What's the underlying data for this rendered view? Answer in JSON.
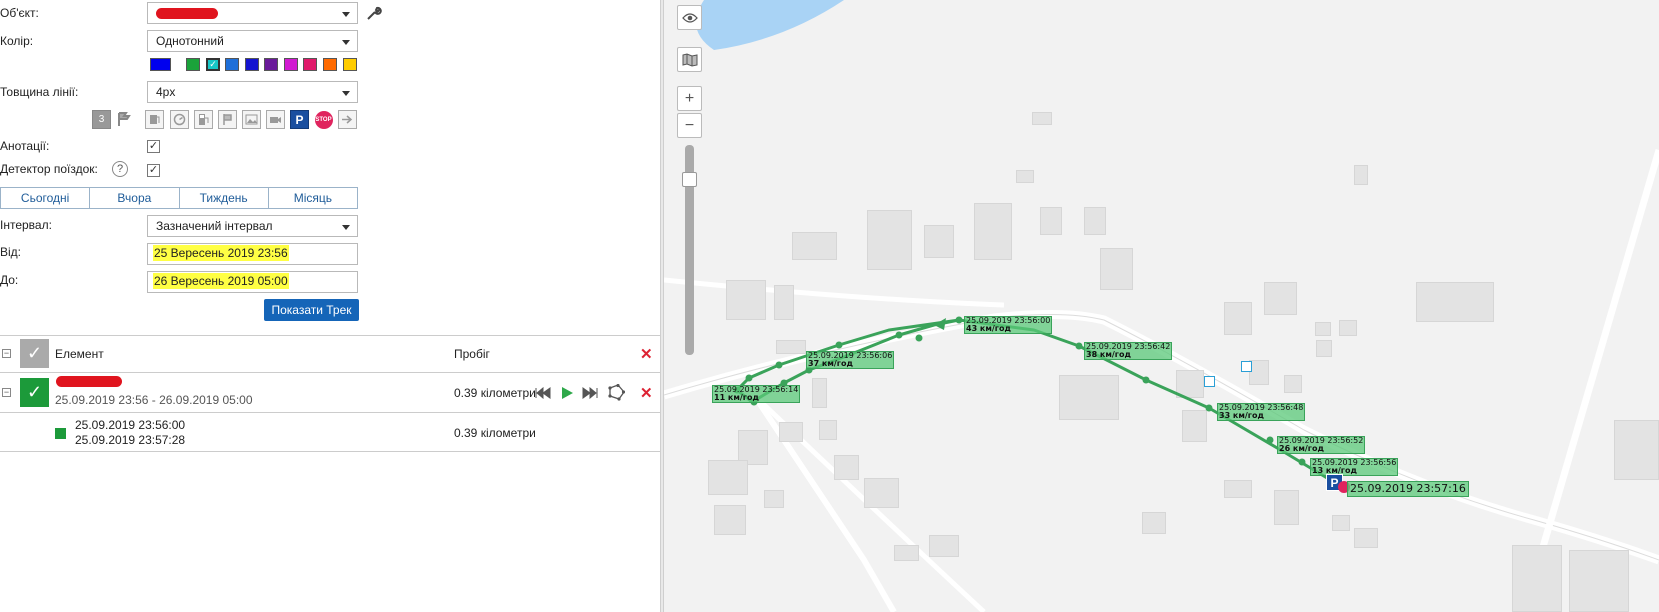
{
  "form": {
    "object_label": "Об'єкт:",
    "color_label": "Колір:",
    "color_value": "Однотонний",
    "line_width_label": "Товщина лінії:",
    "line_width_value": "4px",
    "annotations_label": "Анотації:",
    "trip_detector_label": "Детектор поїздок:",
    "interval_label": "Інтервал:",
    "interval_value": "Зазначений інтервал",
    "from_label": "Від:",
    "from_value": "25 Вересень 2019 23:56",
    "to_label": "До:",
    "to_value": "26 Вересень 2019 05:00",
    "show_track_label": "Показати Трек",
    "help_glyph": "?"
  },
  "swatches": [
    "#0000ee",
    "#1aa33a",
    "#17c7c7",
    "#1e6fd9",
    "#1414d0",
    "#6a1a9a",
    "#d11ad1",
    "#e01a6a",
    "#ff6a00",
    "#ffcc00"
  ],
  "quick_periods": [
    "Сьогодні",
    "Вчора",
    "Тиждень",
    "Місяць"
  ],
  "tools": {
    "t0": "3",
    "t11": "P",
    "t12": "STOP"
  },
  "table": {
    "col_element": "Елемент",
    "col_mileage": "Пробіг",
    "track": {
      "range": "25.09.2019  23:56 - 26.09.2019  05:00",
      "mileage": "0.39 кілометри"
    },
    "trip": {
      "start": "25.09.2019 23:56:00",
      "end": "25.09.2019 23:57:28",
      "mileage": "0.39 кілометри"
    }
  },
  "map": {
    "track_color": "#3aa35a",
    "annotations": [
      {
        "time": "25.09.2019 23:56:00",
        "speed": "43 км/год"
      },
      {
        "time": "25.09.2019 23:56:42",
        "speed": "38 км/год"
      },
      {
        "time": "25.09.2019 23:56:06",
        "speed": "37 км/год"
      },
      {
        "time": "25.09.2019 23:56:14",
        "speed": "11 км/год"
      },
      {
        "time": "25.09.2019 23:56:48",
        "speed": "33 км/год"
      },
      {
        "time": "25.09.2019 23:56:52",
        "speed": "26 км/год"
      },
      {
        "time": "25.09.2019 23:56:56",
        "speed": "13 км/год"
      }
    ],
    "end_label": "25.09.2019 23:57:16",
    "parking_glyph": "P",
    "zoom_in": "+",
    "zoom_out": "−"
  }
}
